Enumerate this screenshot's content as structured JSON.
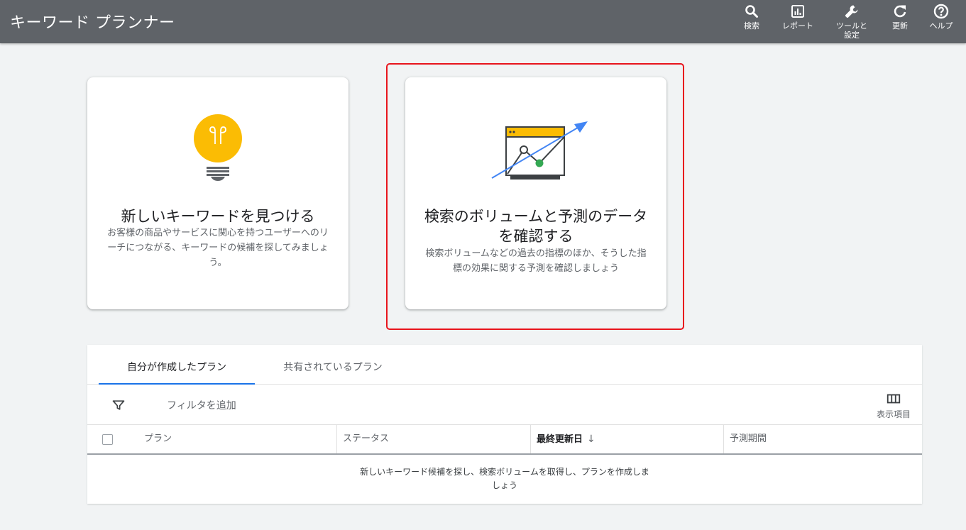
{
  "header": {
    "title": "キーワード プランナー",
    "buttons": [
      {
        "label": "検索",
        "icon": "search-icon"
      },
      {
        "label": "レポート",
        "icon": "report-icon"
      },
      {
        "label": "ツールと\n設定",
        "icon": "wrench-icon"
      },
      {
        "label": "更新",
        "icon": "refresh-icon"
      },
      {
        "label": "ヘルプ",
        "icon": "help-icon"
      }
    ]
  },
  "cards": [
    {
      "title": "新しいキーワードを見つける",
      "description": "お客様の商品やサービスに関心を持つユーザーへのリーチにつながる、キーワードの候補を探してみましょう。",
      "icon": "lightbulb-icon"
    },
    {
      "title": "検索のボリュームと予測のデータを確認する",
      "description": "検索ボリュームなどの過去の指標のほか、そうした指標の効果に関する予測を確認しましょう",
      "icon": "forecast-chart-icon"
    }
  ],
  "plans": {
    "tabs": [
      {
        "label": "自分が作成したプラン",
        "active": true
      },
      {
        "label": "共有されているプラン",
        "active": false
      }
    ],
    "filter_placeholder": "フィルタを追加",
    "columns_button_label": "表示項目",
    "columns": [
      "プラン",
      "ステータス",
      "最終更新日",
      "予測期間"
    ],
    "sort_column": "最終更新日",
    "sort_direction": "descending",
    "empty_message": "新しいキーワード候補を探し、検索ボリュームを取得し、プランを作成しましょう"
  },
  "colors": {
    "topbar": "#5f6368",
    "accent_blue": "#1a73e8",
    "highlight_red": "#e8141c",
    "bulb_yellow": "#fbbc04",
    "dot_green": "#34a853"
  }
}
